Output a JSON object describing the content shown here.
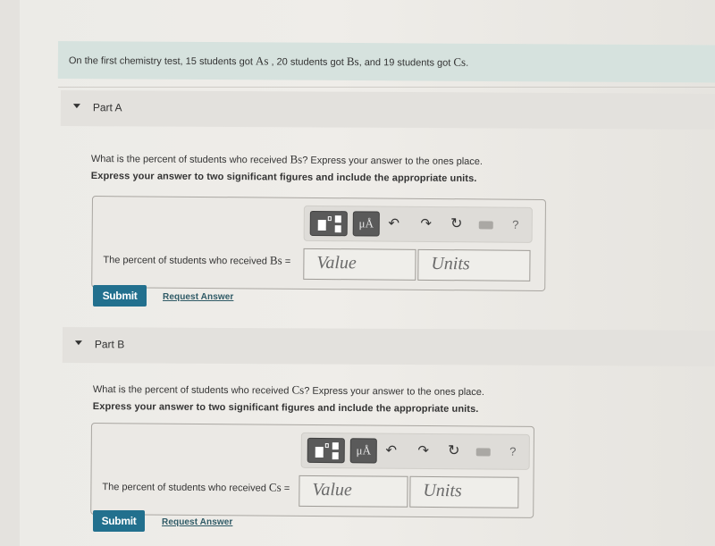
{
  "intro": {
    "text_before_a": "On the first chemistry test, 15 students got ",
    "grade_a": "As",
    "text_before_b": " , 20 students got ",
    "grade_b": "Bs",
    "text_before_c": ", and 19 students got ",
    "grade_c": "Cs",
    "text_end": "."
  },
  "parts": [
    {
      "title": "Part A",
      "question_prefix": "What is the percent of students who received ",
      "question_grade": "Bs",
      "question_suffix": "? Express your answer to the ones place.",
      "instruction": "Express your answer to two significant figures and include the appropriate units.",
      "label_prefix": "The percent of students who received ",
      "label_grade": "Bs",
      "label_suffix": " =",
      "value_placeholder": "Value",
      "units_placeholder": "Units",
      "submit_label": "Submit",
      "request_answer_label": "Request Answer"
    },
    {
      "title": "Part B",
      "question_prefix": "What is the percent of students who received ",
      "question_grade": "Cs",
      "question_suffix": "? Express your answer to the ones place.",
      "instruction": "Express your answer to two significant figures and include the appropriate units.",
      "label_prefix": "The percent of students who received ",
      "label_grade": "Cs",
      "label_suffix": " =",
      "value_placeholder": "Value",
      "units_placeholder": "Units",
      "submit_label": "Submit",
      "request_answer_label": "Request Answer"
    }
  ],
  "toolbar": {
    "units_button_label": "μÅ",
    "undo_icon": "↶",
    "redo_icon": "↷",
    "reset_icon": "↻",
    "help_label": "?"
  },
  "colors": {
    "intro_bg": "#d6e2de",
    "submit_bg": "#22708e",
    "link": "#2f5a66"
  }
}
